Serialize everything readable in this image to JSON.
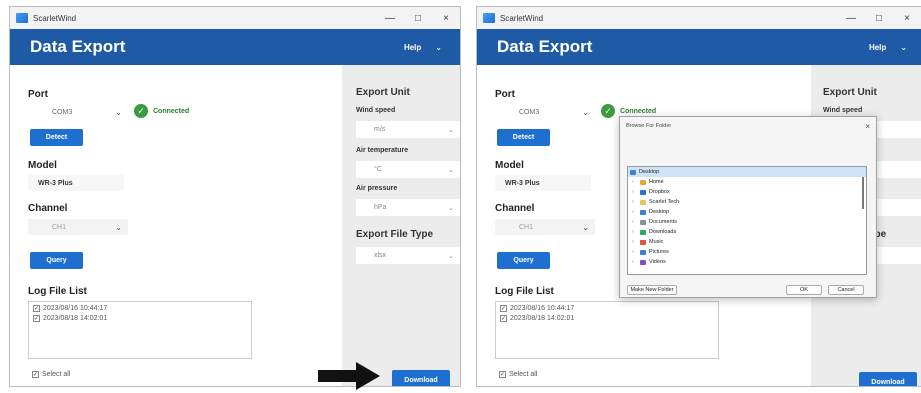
{
  "app": {
    "name": "ScarletWind"
  },
  "window_controls": {
    "minimize": "—",
    "maximize": "□",
    "close": "×"
  },
  "header": {
    "title": "Data Export",
    "help": "Help",
    "help_chevron": "⌄"
  },
  "port": {
    "label": "Port",
    "value": "COM3",
    "status": "Connected",
    "detect_label": "Detect"
  },
  "model": {
    "label": "Model",
    "value": "WR-3 Plus"
  },
  "channel": {
    "label": "Channel",
    "value": "CH1",
    "query_label": "Query"
  },
  "log": {
    "label": "Log File List",
    "items": [
      "2023/08/16 10:44:17",
      "2023/08/18 14:02:01"
    ],
    "select_all": "Select all"
  },
  "export_unit": {
    "label": "Export Unit",
    "wind_speed_label": "Wind speed",
    "wind_speed_value": "m/s",
    "air_temp_label": "Air temperature",
    "air_temp_value": "°C",
    "air_pressure_label": "Air pressure",
    "air_pressure_value": "hPa"
  },
  "export_file_type": {
    "label": "Export File Type",
    "value": "xlsx"
  },
  "download_label": "Download",
  "dialog": {
    "title": "Browse For Folder",
    "close": "×",
    "tree": [
      {
        "label": "Desktop",
        "level": 0,
        "selected": true,
        "color": "#3b82d6"
      },
      {
        "label": "Home",
        "level": 1,
        "color": "#e8a838"
      },
      {
        "label": "Dropbox",
        "level": 1,
        "color": "#2b6fd6"
      },
      {
        "label": "Scarlet Tech",
        "level": 1,
        "color": "#e8c55a"
      },
      {
        "label": "Desktop",
        "level": 1,
        "color": "#3b82d6"
      },
      {
        "label": "Documents",
        "level": 1,
        "color": "#8a8f99"
      },
      {
        "label": "Downloads",
        "level": 1,
        "color": "#2fa866"
      },
      {
        "label": "Music",
        "level": 1,
        "color": "#e0533d"
      },
      {
        "label": "Pictures",
        "level": 1,
        "color": "#3a7fd9"
      },
      {
        "label": "Videos",
        "level": 1,
        "color": "#7a4fd1"
      }
    ],
    "new_folder": "Make New Folder",
    "ok": "OK",
    "cancel": "Cancel"
  },
  "right_panel_partial": {
    "type_fragment": "ype"
  }
}
